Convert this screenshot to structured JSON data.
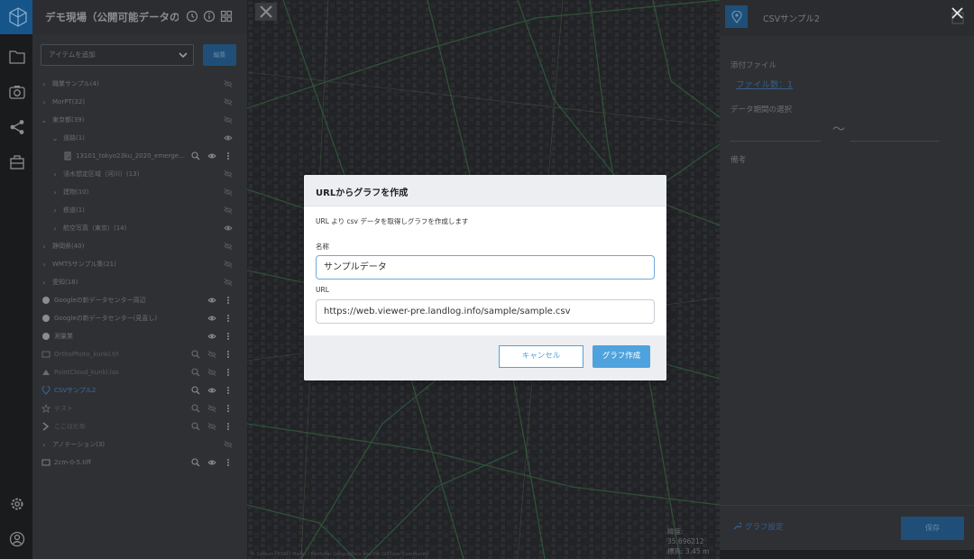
{
  "project": {
    "title": "デモ現場（公開可能データの…"
  },
  "layer_panel": {
    "add_item_placeholder": "アイテムを追加",
    "edit_label": "編集",
    "items": [
      {
        "label": "職業サンプル(4)"
      },
      {
        "label": "MorPT(32)"
      },
      {
        "label": "東京都(39)"
      },
      {
        "label": "道路(1)"
      },
      {
        "label": "13101_tokyo23ku_2020_emergency_..."
      },
      {
        "label": "浸水想定区域（河川）(13)"
      },
      {
        "label": "建物(10)"
      },
      {
        "label": "鉄道(1)"
      },
      {
        "label": "航空写真（東京）(14)"
      },
      {
        "label": "静岡県(40)"
      },
      {
        "label": "WMTSサンプル集(21)"
      },
      {
        "label": "愛知(18)"
      },
      {
        "label": "Googleの新データセンター周辺"
      },
      {
        "label": "Googleの新データセンター(見直し)"
      },
      {
        "label": "測量業"
      },
      {
        "label": "OrthoPhoto_kunkl.tif"
      },
      {
        "label": "PointCloud_kunkl.las"
      },
      {
        "label": "CSVサンプル2"
      },
      {
        "label": "テスト"
      },
      {
        "label": "ここはだめ"
      },
      {
        "label": "アノテーション(3)"
      },
      {
        "label": "2cm-0-5.tiff"
      }
    ]
  },
  "map": {
    "coords_line1": "緯度: 35.696212",
    "coords_line2": "標高: 3.45 m",
    "credit": "© Cesium / ESRI / Maxar / Earthstar Geographics and the GIS User Community"
  },
  "detail": {
    "title": "CSVサンプル2",
    "attachments_label": "添付ファイル",
    "file_count_link": "ファイル数：1",
    "period_label": "データ期間の選択",
    "tilde": "〜",
    "notes_label": "備考",
    "graph_setting": "グラフ設定",
    "save_label": "保存"
  },
  "modal": {
    "title": "URLからグラフを作成",
    "description": "URL より csv データを取得しグラフを作成します",
    "name_label": "名称",
    "name_value": "サンプルデータ",
    "url_label": "URL",
    "url_value": "https://web.viewer-pre.landlog.info/sample/sample.csv",
    "cancel_label": "キャンセル",
    "create_label": "グラフ作成"
  },
  "colors": {
    "accent": "#4ea2dd",
    "brand": "#15558a"
  }
}
